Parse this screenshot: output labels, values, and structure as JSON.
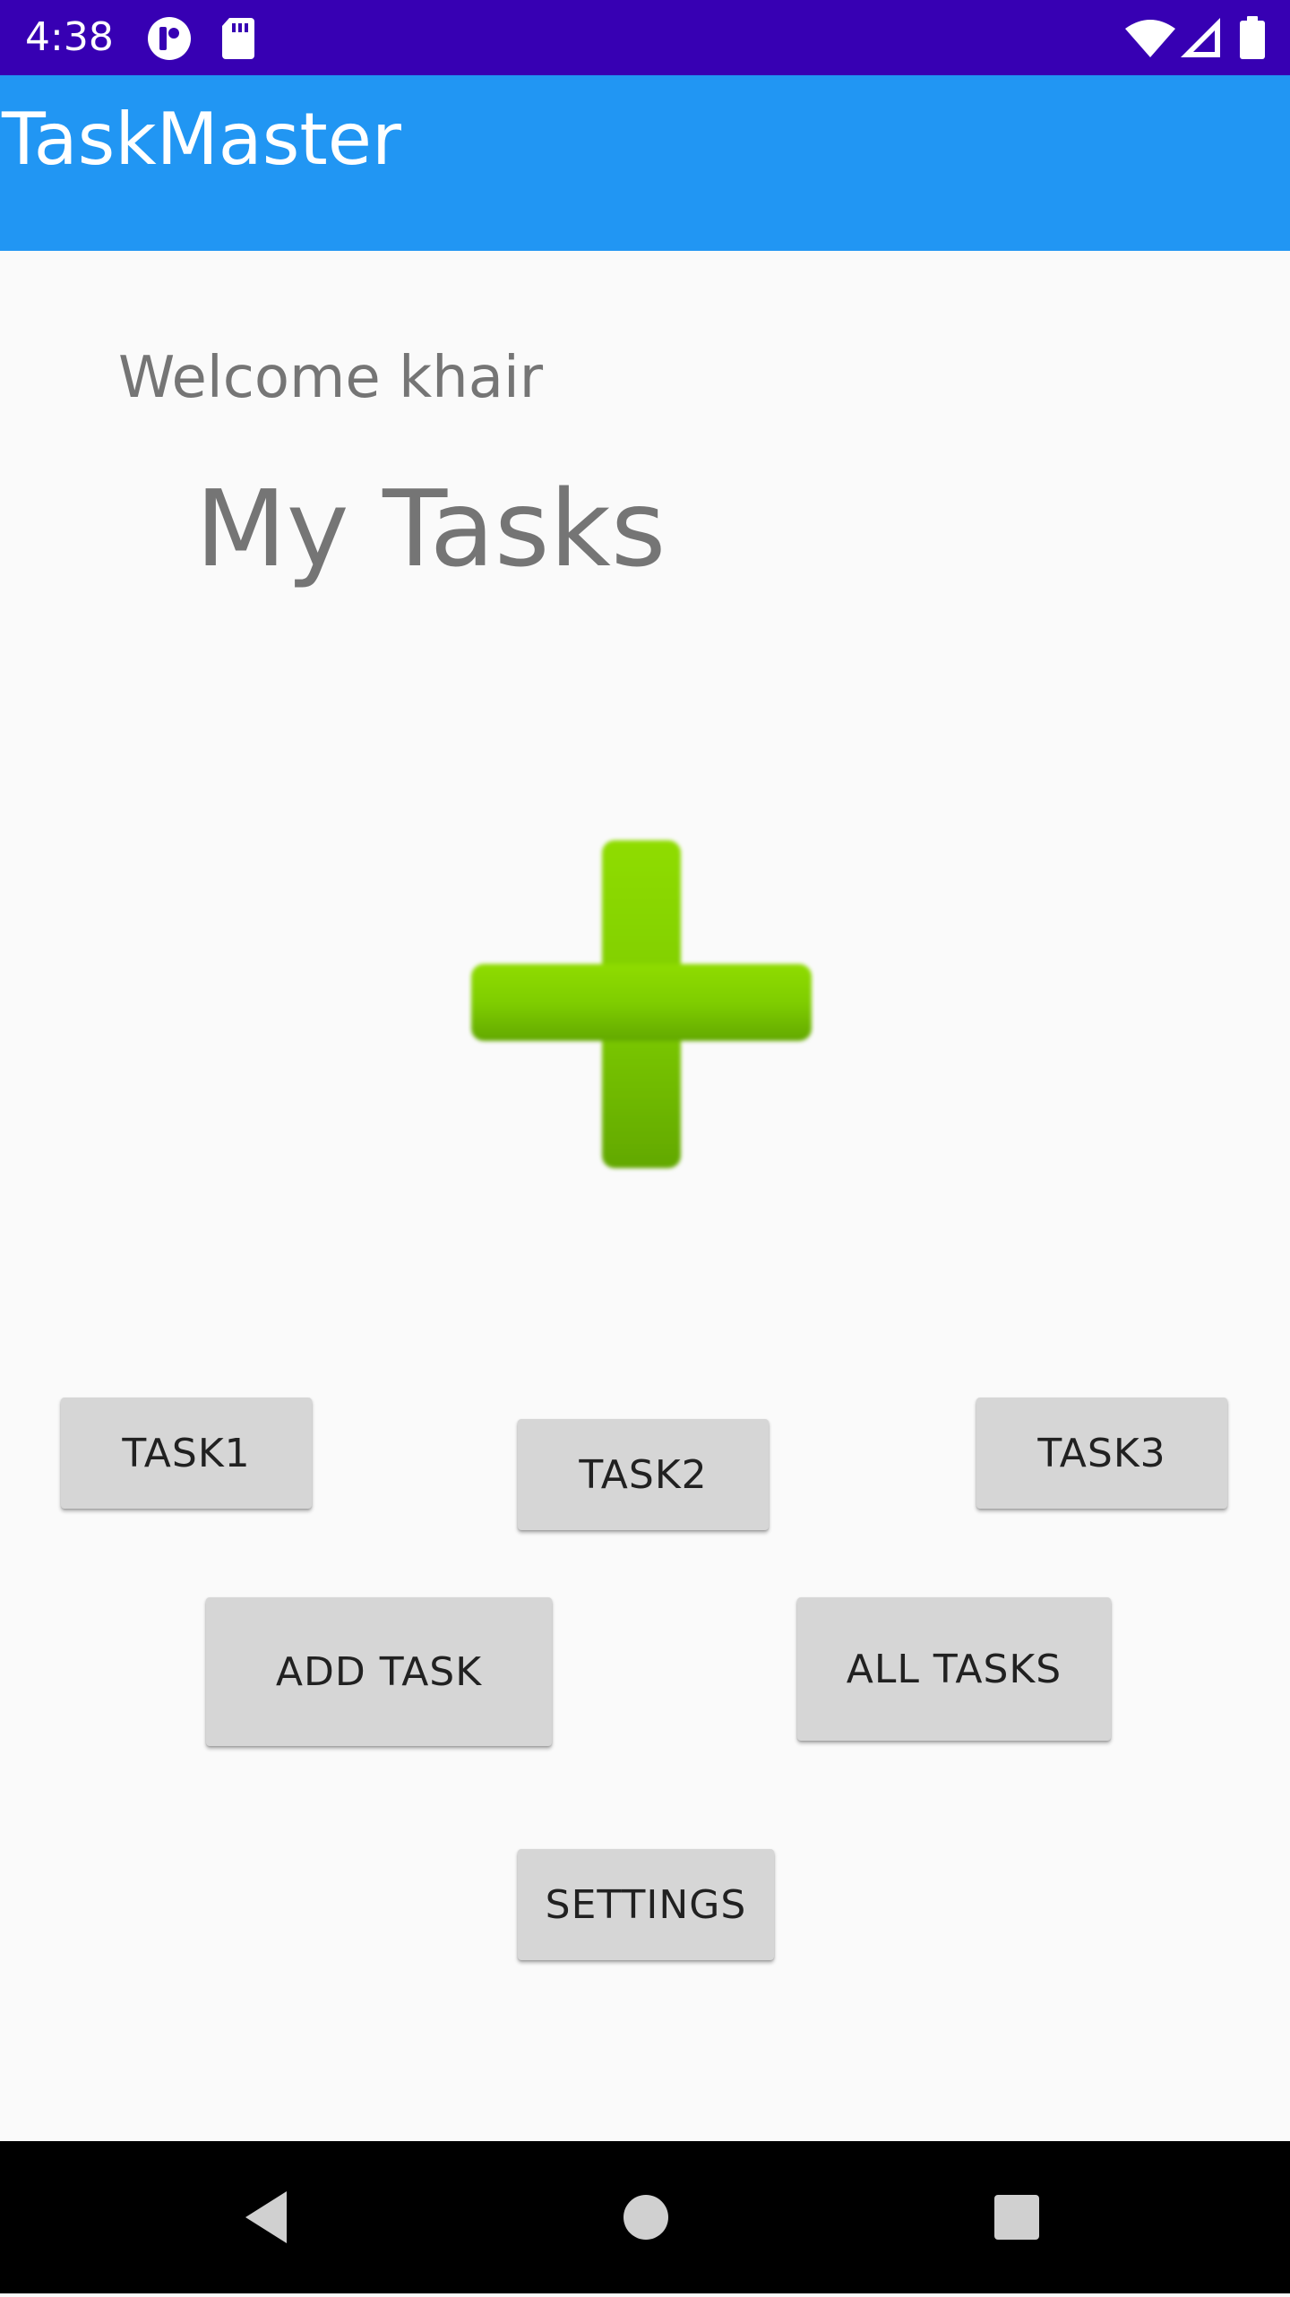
{
  "status_bar": {
    "time": "4:38",
    "icons": [
      "app-notification-icon",
      "sd-card-icon",
      "wifi-icon",
      "cell-signal-icon",
      "battery-icon"
    ]
  },
  "app_bar": {
    "title": "TaskMaster",
    "color": "#2196f3"
  },
  "main": {
    "welcome": "Welcome khair",
    "heading": "My Tasks",
    "hero_icon": "add-plus-icon"
  },
  "buttons": {
    "task1": "TASK1",
    "task2": "TASK2",
    "task3": "TASK3",
    "add_task": "ADD TASK",
    "all_tasks": "ALL TASKS",
    "settings": "SETTINGS"
  },
  "nav_bar": {
    "icons": [
      "back-icon",
      "home-icon",
      "recents-icon"
    ]
  },
  "colors": {
    "status_bar": "#3700b3",
    "accent": "#2196f3",
    "background": "#fafafa",
    "button": "#d6d6d6",
    "plus_green": "#7ccd00"
  }
}
